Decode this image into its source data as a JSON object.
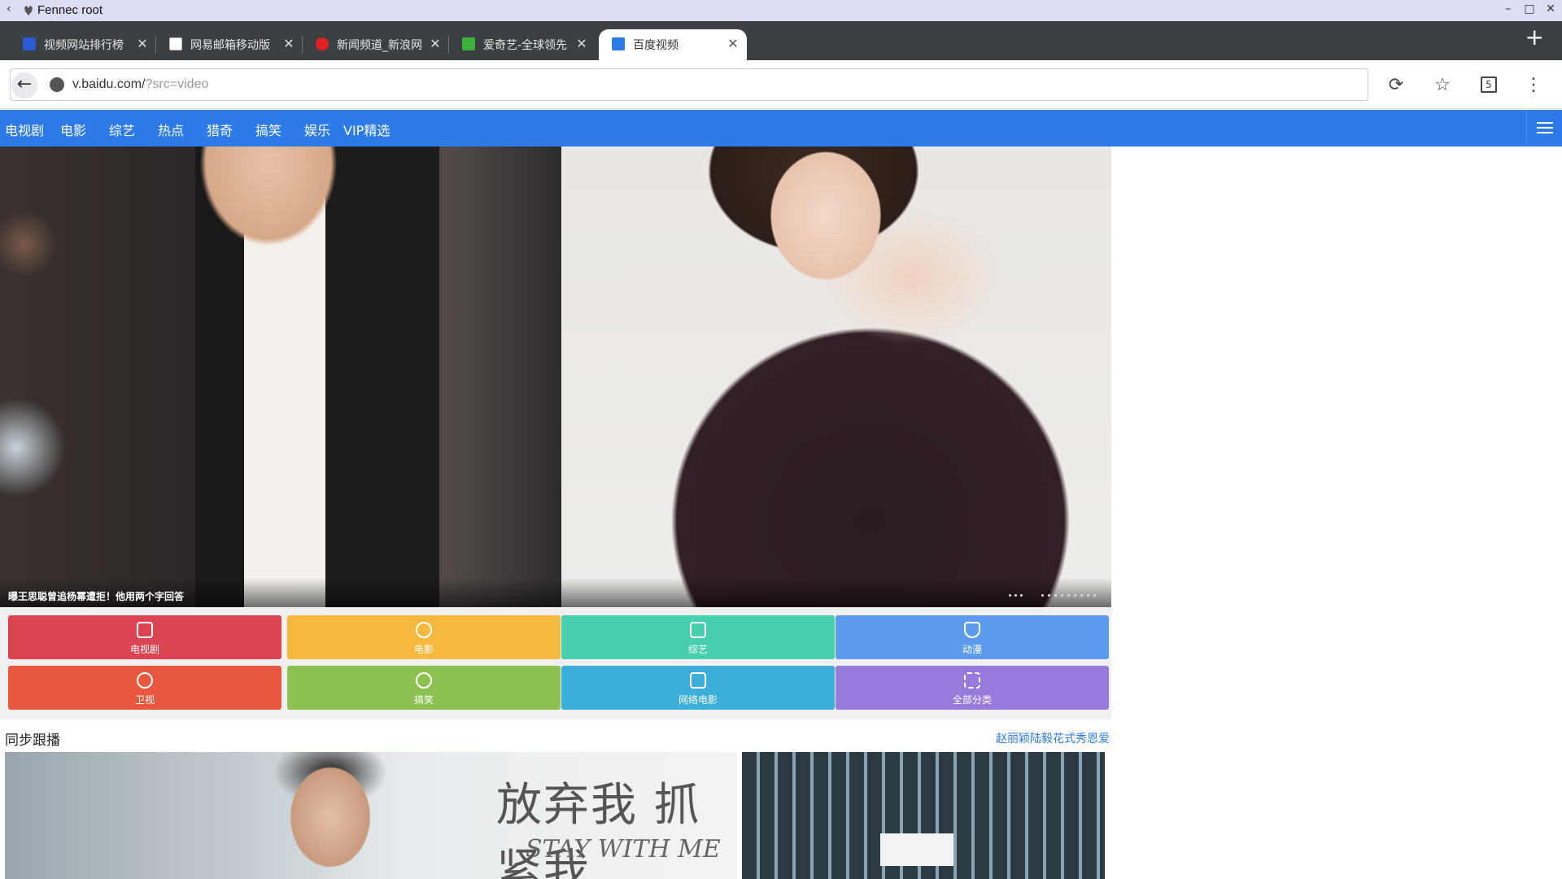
{
  "os": {
    "back_glyph": "‹",
    "title": "Fennec root",
    "minimize": "–",
    "maximize": "□",
    "close": "✕"
  },
  "tabs": [
    {
      "label": "视频网站排行榜",
      "favicon_color": "#2b5cd6",
      "close": "✕"
    },
    {
      "label": "网易邮箱移动版",
      "favicon_color": "#bbbbbb",
      "close": "✕"
    },
    {
      "label": "新闻频道_新浪网",
      "favicon_color": "#e02020",
      "close": "✕"
    },
    {
      "label": "爱奇艺-全球领先",
      "favicon_color": "#3db33d",
      "close": "✕"
    },
    {
      "label": "百度视频",
      "favicon_color": "#2d7be8",
      "close": "✕",
      "active": true
    }
  ],
  "new_tab": "+",
  "toolbar": {
    "back": "←",
    "url_host": "v.baidu.com/",
    "url_rest": "?src=video",
    "reload": "⟳",
    "bookmark": "☆",
    "tab_count": "5",
    "menu": "⋮"
  },
  "site_nav": [
    "电视剧",
    "电影",
    "综艺",
    "热点",
    "猎奇",
    "搞笑",
    "娱乐",
    "VIP精选"
  ],
  "banner": {
    "title": "曝王思聪曾追杨幂遭拒！他用两个字回答",
    "dots": 12
  },
  "categories": [
    {
      "label": "电视剧",
      "color": "#dc4452",
      "icon": "tv-icon"
    },
    {
      "label": "电影",
      "color": "#f5b93f",
      "icon": "film-reel-icon"
    },
    {
      "label": "综艺",
      "color": "#48cfad",
      "icon": "variety-icon"
    },
    {
      "label": "动漫",
      "color": "#5d9cec",
      "icon": "anime-icon"
    },
    {
      "label": "卫视",
      "color": "#e9573f",
      "icon": "satellite-icon"
    },
    {
      "label": "搞笑",
      "color": "#8cc152",
      "icon": "funny-icon"
    },
    {
      "label": "网络电影",
      "color": "#3bafda",
      "icon": "web-movie-icon"
    },
    {
      "label": "全部分类",
      "color": "#967adc",
      "icon": "all-categories-icon"
    }
  ],
  "section": {
    "title": "同步跟播",
    "link": "赵丽颖陆毅花式秀恩爱",
    "poster_text_1": "放弃我 抓紧我",
    "poster_text_2": "STAY WITH ME"
  }
}
